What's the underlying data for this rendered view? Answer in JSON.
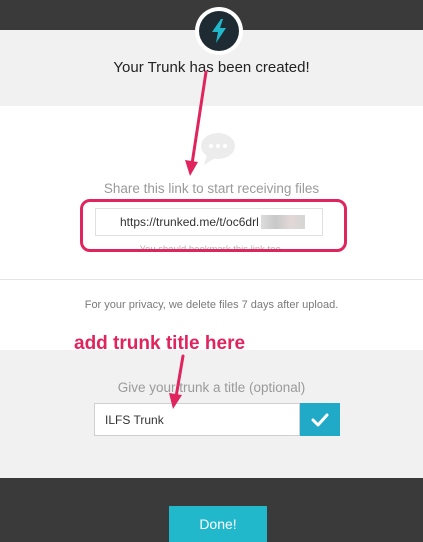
{
  "modal": {
    "title": "Your Trunk has been created!",
    "share_label": "Share this link to start receiving files",
    "link_url": "https://trunked.me/t/oc6drl",
    "bookmark_note": "You should bookmark this link too.",
    "privacy_note": "For your privacy, we delete files 7 days after upload.",
    "title_prompt": "Give your trunk a title (optional)",
    "title_input_value": "ILFS Trunk",
    "done_label": "Done!"
  },
  "annotation": {
    "text": "add trunk title here",
    "color": "#e0245e"
  },
  "icons": {
    "logo": "lightning-bolt-icon",
    "chat": "chat-bubble-icon",
    "confirm": "checkmark-icon"
  },
  "colors": {
    "accent": "#21b8cc",
    "logo_bg": "#1f2b33",
    "page_bg": "#3a3a3a",
    "annotation": "#e0245e"
  }
}
